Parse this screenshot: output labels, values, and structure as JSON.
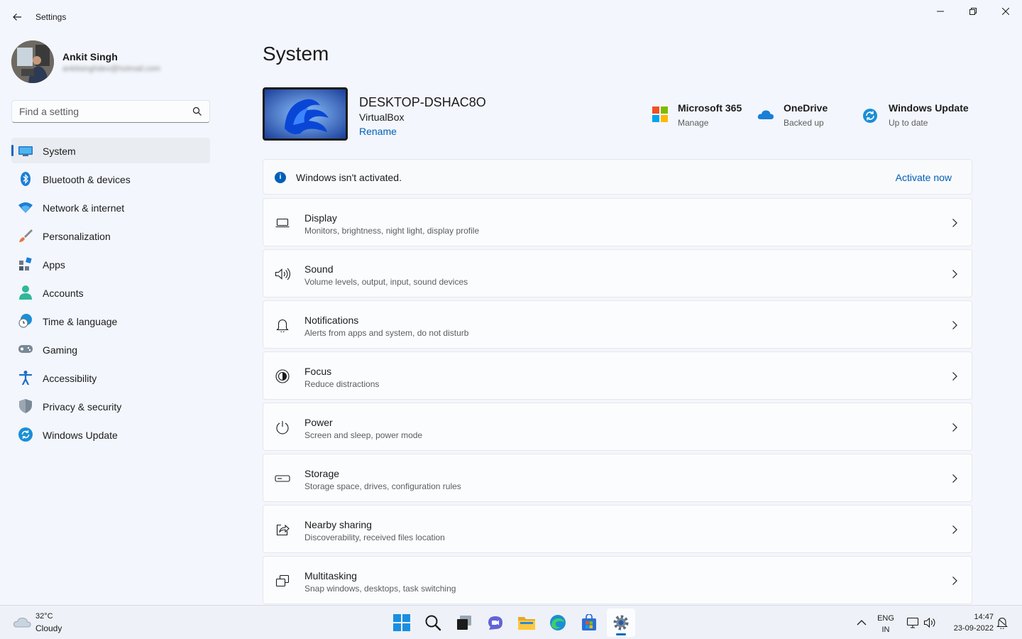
{
  "window": {
    "title": "Settings"
  },
  "profile": {
    "name": "Ankit Singh",
    "email": "ankitsinghdev@hotmail.com"
  },
  "search": {
    "placeholder": "Find a setting"
  },
  "nav": {
    "items": [
      {
        "label": "System",
        "icon": "monitor-icon",
        "active": true
      },
      {
        "label": "Bluetooth & devices",
        "icon": "bluetooth-icon"
      },
      {
        "label": "Network & internet",
        "icon": "wifi-icon"
      },
      {
        "label": "Personalization",
        "icon": "brush-icon"
      },
      {
        "label": "Apps",
        "icon": "apps-icon"
      },
      {
        "label": "Accounts",
        "icon": "person-icon"
      },
      {
        "label": "Time & language",
        "icon": "globe-clock-icon"
      },
      {
        "label": "Gaming",
        "icon": "gamepad-icon"
      },
      {
        "label": "Accessibility",
        "icon": "accessibility-icon"
      },
      {
        "label": "Privacy & security",
        "icon": "shield-icon"
      },
      {
        "label": "Windows Update",
        "icon": "sync-icon"
      }
    ]
  },
  "main": {
    "title": "System",
    "device": {
      "name": "DESKTOP-DSHAC8O",
      "model": "VirtualBox",
      "rename": "Rename"
    },
    "tiles": [
      {
        "title": "Microsoft 365",
        "subtitle": "Manage",
        "icon": "microsoft-logo-icon"
      },
      {
        "title": "OneDrive",
        "subtitle": "Backed up",
        "icon": "cloud-icon"
      },
      {
        "title": "Windows Update",
        "subtitle": "Up to date",
        "icon": "sync-icon"
      }
    ],
    "banner": {
      "text": "Windows isn't activated.",
      "action": "Activate now",
      "icon_text": "i"
    },
    "settings": [
      {
        "title": "Display",
        "subtitle": "Monitors, brightness, night light, display profile",
        "icon": "laptop-icon"
      },
      {
        "title": "Sound",
        "subtitle": "Volume levels, output, input, sound devices",
        "icon": "speaker-icon"
      },
      {
        "title": "Notifications",
        "subtitle": "Alerts from apps and system, do not disturb",
        "icon": "bell-icon"
      },
      {
        "title": "Focus",
        "subtitle": "Reduce distractions",
        "icon": "focus-icon"
      },
      {
        "title": "Power",
        "subtitle": "Screen and sleep, power mode",
        "icon": "power-icon"
      },
      {
        "title": "Storage",
        "subtitle": "Storage space, drives, configuration rules",
        "icon": "drive-icon"
      },
      {
        "title": "Nearby sharing",
        "subtitle": "Discoverability, received files location",
        "icon": "share-icon"
      },
      {
        "title": "Multitasking",
        "subtitle": "Snap windows, desktops, task switching",
        "icon": "multitask-icon"
      }
    ]
  },
  "taskbar": {
    "weather": {
      "temp": "32°C",
      "desc": "Cloudy"
    },
    "lang": {
      "line1": "ENG",
      "line2": "IN"
    },
    "clock": {
      "time": "14:47",
      "date": "23-09-2022"
    }
  },
  "colors": {
    "accent": "#0067c0",
    "link": "#005fb8",
    "background": "#f3f6fc"
  }
}
